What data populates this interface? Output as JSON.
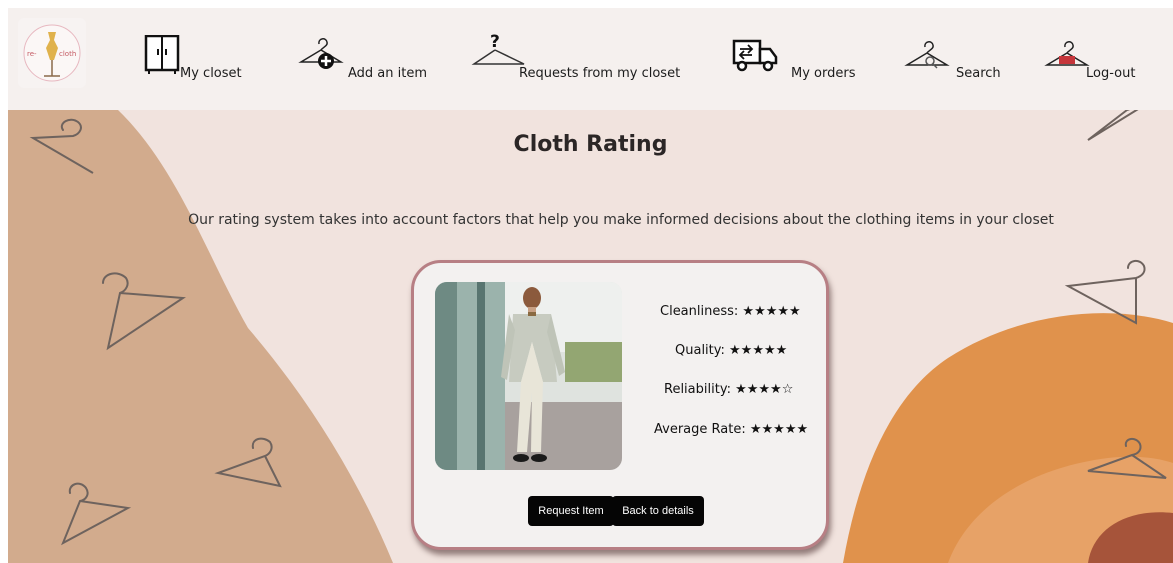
{
  "nav": {
    "logo_text": "re-cloth",
    "items": [
      {
        "label": "My closet",
        "icon": "wardrobe-icon"
      },
      {
        "label": "Add an item",
        "icon": "hanger-plus-icon"
      },
      {
        "label": "Requests from my closet",
        "icon": "hanger-question-icon"
      },
      {
        "label": "My orders",
        "icon": "delivery-truck-icon"
      },
      {
        "label": "Search",
        "icon": "hanger-search-icon"
      },
      {
        "label": "Log-out",
        "icon": "hanger-exit-icon"
      }
    ]
  },
  "page": {
    "title": "Cloth Rating",
    "subtitle": "Our rating system takes into account factors that help you make informed decisions about the clothing items in your closet"
  },
  "card": {
    "ratings": [
      {
        "label": "Cleanliness:",
        "stars": "★★★★★"
      },
      {
        "label": "Quality:",
        "stars": "★★★★★"
      },
      {
        "label": "Reliability:",
        "stars": "★★★★☆"
      },
      {
        "label": "Average Rate:",
        "stars": "★★★★★"
      }
    ],
    "request_button": "Request Item",
    "back_button": "Back to details"
  },
  "colors": {
    "accent_orange": "#e0954f",
    "tan": "#d3aa8c",
    "card_border": "#b77f84",
    "background": "#f1e3de"
  }
}
